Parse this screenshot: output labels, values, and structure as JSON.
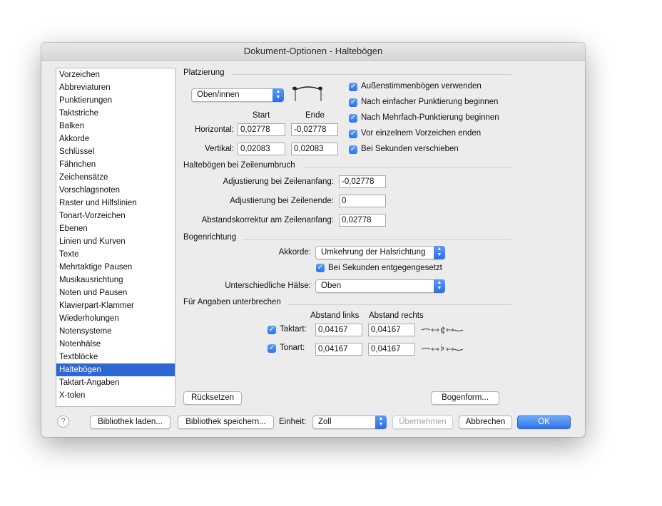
{
  "window": {
    "title": "Dokument-Optionen - Haltebögen"
  },
  "sidebar": {
    "items": [
      {
        "label": "Vorzeichen"
      },
      {
        "label": "Abbreviaturen"
      },
      {
        "label": "Punktierungen"
      },
      {
        "label": "Taktstriche"
      },
      {
        "label": "Balken"
      },
      {
        "label": "Akkorde"
      },
      {
        "label": "Schlüssel"
      },
      {
        "label": "Fähnchen"
      },
      {
        "label": "Zeichensätze"
      },
      {
        "label": "Vorschlagsnoten"
      },
      {
        "label": "Raster und Hilfslinien"
      },
      {
        "label": "Tonart-Vorzeichen"
      },
      {
        "label": "Ebenen"
      },
      {
        "label": "Linien und Kurven"
      },
      {
        "label": "Texte"
      },
      {
        "label": "Mehrtaktige Pausen"
      },
      {
        "label": "Musikausrichtung"
      },
      {
        "label": "Noten und Pausen"
      },
      {
        "label": "Klavierpart-Klammer"
      },
      {
        "label": "Wiederholungen"
      },
      {
        "label": "Notensysteme"
      },
      {
        "label": "Notenhälse"
      },
      {
        "label": "Textblöcke"
      },
      {
        "label": "Haltebögen",
        "selected": true
      },
      {
        "label": "Taktart-Angaben"
      },
      {
        "label": "X-tolen"
      }
    ]
  },
  "placement": {
    "title": "Platzierung",
    "popup": "Oben/innen",
    "col_start": "Start",
    "col_end": "Ende",
    "horizontal_label": "Horizontal:",
    "horizontal_start": "0,02778",
    "horizontal_end": "-0,02778",
    "vertical_label": "Vertikal:",
    "vertical_start": "0,02083",
    "vertical_end": "0,02083",
    "checks": [
      {
        "label": "Außenstimmenbögen verwenden",
        "checked": true
      },
      {
        "label": "Nach einfacher Punktierung beginnen",
        "checked": true
      },
      {
        "label": "Nach Mehrfach-Punktierung beginnen",
        "checked": true
      },
      {
        "label": "Vor einzelnem Vorzeichen enden",
        "checked": true
      },
      {
        "label": "Bei Sekunden verschieben",
        "checked": true
      }
    ]
  },
  "linebreak": {
    "title": "Haltebögen bei Zeilenumbruch",
    "start_label": "Adjustierung bei Zeilenanfang:",
    "start_value": "-0,02778",
    "end_label": "Adjustierung bei Zeilenende:",
    "end_value": "0",
    "gap_label": "Abstandskorrektur am Zeilenanfang:",
    "gap_value": "0,02778"
  },
  "direction": {
    "title": "Bogenrichtung",
    "chords_label": "Akkorde:",
    "chords_value": "Umkehrung der Halsrichtung",
    "seconds_label": "Bei Sekunden entgegengesetzt",
    "stems_label": "Unterschiedliche Hälse:",
    "stems_value": "Oben"
  },
  "interrupt": {
    "title": "Für Angaben unterbrechen",
    "col_left": "Abstand links",
    "col_right": "Abstand rechts",
    "time_label": "Taktart:",
    "time_left": "0,04167",
    "time_right": "0,04167",
    "key_label": "Tonart:",
    "key_left": "0,04167",
    "key_right": "0,04167"
  },
  "buttons": {
    "reset": "Rücksetzen",
    "tie_shape": "Bogenform...",
    "load_library": "Bibliothek laden...",
    "save_library": "Bibliothek speichern...",
    "unit_label": "Einheit:",
    "unit_value": "Zoll",
    "apply": "Übernehmen",
    "cancel": "Abbrechen",
    "ok": "OK",
    "help": "?"
  },
  "colors": {
    "accent": "#2e66d3",
    "window_bg": "#ececec"
  }
}
